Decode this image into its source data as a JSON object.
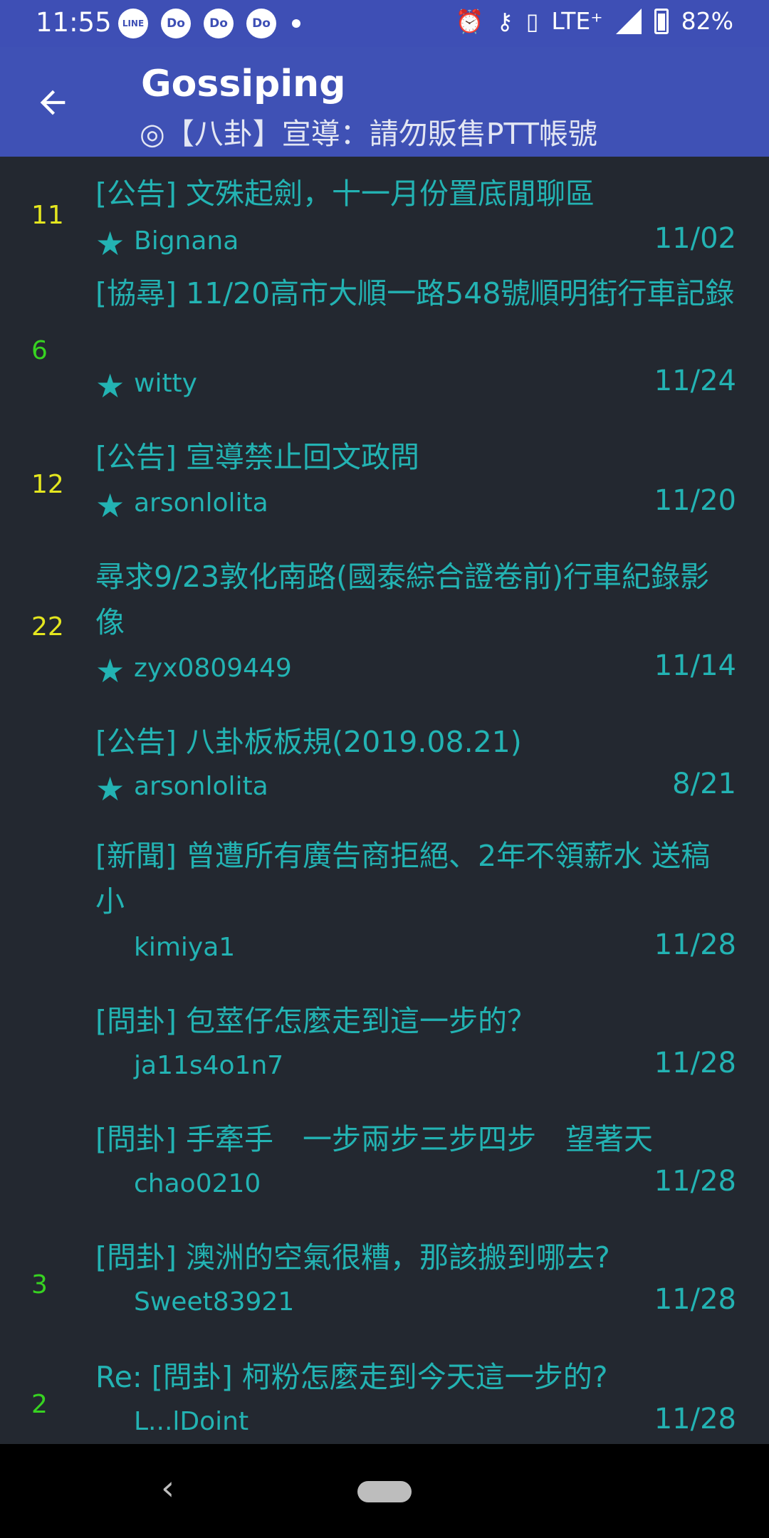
{
  "status_bar": {
    "time": "11:55",
    "notifications": [
      "LINE",
      "Do",
      "Do",
      "Do"
    ],
    "network": "LTE⁺",
    "battery": "82%",
    "icons": [
      "alarm-icon",
      "vpn-key-icon",
      "vibrate-icon",
      "signal-icon",
      "battery-icon"
    ]
  },
  "app_bar": {
    "title": "Gossiping",
    "subtitle": "◎【八卦】宣導：請勿販售PTT帳號"
  },
  "posts": [
    {
      "push": "11",
      "push_color": "yellow",
      "title": "[公告] 文殊起劍，十一月份置底閒聊區",
      "author": "Bignana",
      "date": "11/02",
      "starred": true
    },
    {
      "push": "6",
      "push_color": "green",
      "title": "[協尋] 11/20高市大順一路548號順明街行車記錄",
      "author": "witty",
      "date": "11/24",
      "starred": true
    },
    {
      "push": "12",
      "push_color": "yellow",
      "title": "[公告] 宣導禁止回文政問",
      "author": "arsonlolita",
      "date": "11/20",
      "starred": true
    },
    {
      "push": "22",
      "push_color": "yellow",
      "title": "尋求9/23敦化南路(國泰綜合證卷前)行車紀錄影像",
      "author": "zyx0809449",
      "date": "11/14",
      "starred": true
    },
    {
      "push": "",
      "push_color": "",
      "title": "[公告] 八卦板板規(2019.08.21)",
      "author": "arsonlolita",
      "date": "8/21",
      "starred": true
    },
    {
      "push": "",
      "push_color": "",
      "title": "[新聞] 曾遭所有廣告商拒絕、2年不領薪水 送稿小",
      "author": "kimiya1",
      "date": "11/28",
      "starred": false
    },
    {
      "push": "",
      "push_color": "",
      "title": "[問卦] 包莖仔怎麼走到這一步的？",
      "author": "ja11s4o1n7",
      "date": "11/28",
      "starred": false
    },
    {
      "push": "",
      "push_color": "",
      "title": "[問卦] 手牽手　一步兩步三步四步　望著天",
      "author": "chao0210",
      "date": "11/28",
      "starred": false
    },
    {
      "push": "3",
      "push_color": "green",
      "title": "[問卦] 澳洲的空氣很糟，那該搬到哪去?",
      "author": "Sweet83921",
      "date": "11/28",
      "starred": false
    },
    {
      "push": "2",
      "push_color": "green",
      "title": "Re: [問卦] 柯粉怎麼走到今天這一步的?",
      "author": "L...lDoint",
      "date": "11/28",
      "starred": false
    }
  ],
  "nav_bar": {
    "back": "‹"
  }
}
